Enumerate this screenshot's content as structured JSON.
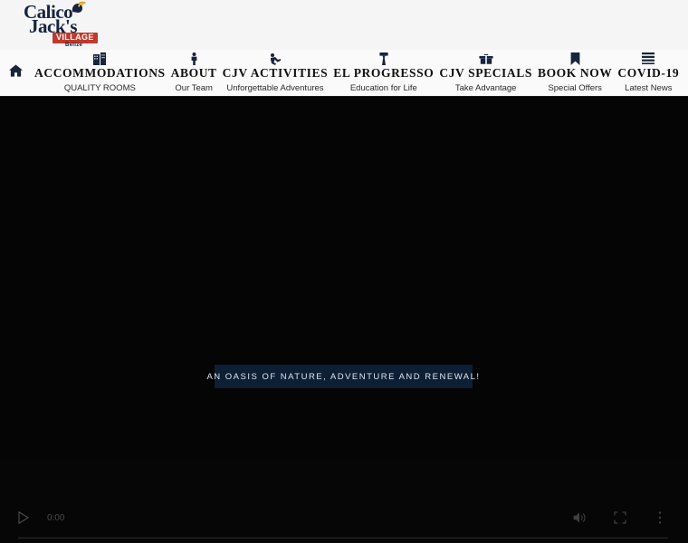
{
  "brand": {
    "name_line1": "Calico",
    "name_line2": "Jack's",
    "badge": "VILLAGE",
    "country": "Belize",
    "logo_icon": "toucan-bird-icon",
    "badge_color": "#c0392b",
    "text_color": "#17243f"
  },
  "nav": {
    "home_icon": "home-icon",
    "items": [
      {
        "icon": "hotel-building-icon",
        "label": "ACCOMMODATIONS",
        "sub": "QUALITY ROOMS"
      },
      {
        "icon": "person-icon",
        "label": "ABOUT",
        "sub": "Our Team"
      },
      {
        "icon": "activities-icon",
        "label": "CJV ACTIVITIES",
        "sub": "Unforgettable Adventures"
      },
      {
        "icon": "graduation-tie-icon",
        "label": "EL PROGRESSO",
        "sub": "Education for Life"
      },
      {
        "icon": "gift-box-icon",
        "label": "CJV SPECIALS",
        "sub": "Take Advantage"
      },
      {
        "icon": "bookmark-icon",
        "label": "BOOK NOW",
        "sub": "Special Offers"
      },
      {
        "icon": "news-list-icon",
        "label": "COVID-19",
        "sub": "Latest News"
      }
    ]
  },
  "hero": {
    "banner_text": "AN OASIS OF NATURE, ADVENTURE AND RENEWAL!",
    "banner_bg": "#0d1f35",
    "background": "#050505"
  },
  "video": {
    "play_icon": "play-icon",
    "current_time": "0:00",
    "volume_icon": "volume-icon",
    "fullscreen_icon": "fullscreen-icon",
    "more_icon": "more-options-icon",
    "progress_percent": 0
  }
}
